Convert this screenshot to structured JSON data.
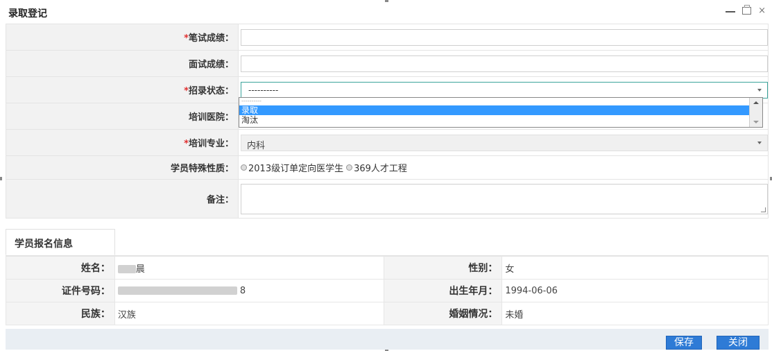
{
  "window": {
    "title": "录取登记",
    "min_icon": "minimize-icon",
    "max_icon": "maximize-icon",
    "close_icon": "close-icon",
    "close_glyph": "×"
  },
  "form": {
    "required_mark": "*",
    "written_score": {
      "label": "笔试成绩：",
      "required": true,
      "value": ""
    },
    "interview_score": {
      "label": "面试成绩：",
      "required": false,
      "value": ""
    },
    "admission_status": {
      "label": "招录状态：",
      "required": true,
      "selected": "----------",
      "options": [
        "----------",
        "录取",
        "淘汰"
      ],
      "highlighted_option": "录取"
    },
    "training_hospital": {
      "label": "培训医院：",
      "required": false,
      "value": ""
    },
    "training_major": {
      "label": "培训专业：",
      "required": true,
      "selected": "内科"
    },
    "special_nature": {
      "label": "学员特殊性质：",
      "options": [
        "2013级订单定向医学生",
        "369人才工程"
      ]
    },
    "remarks": {
      "label": "备注：",
      "value": ""
    }
  },
  "tabs": [
    {
      "label": "学员报名信息",
      "active": true
    }
  ],
  "info": {
    "name": {
      "label": "姓名：",
      "value_suffix": "晨"
    },
    "gender": {
      "label": "性别：",
      "value": "女"
    },
    "id_number": {
      "label": "证件号码：",
      "value_suffix": "8"
    },
    "birth": {
      "label": "出生年月：",
      "value": "1994-06-06"
    },
    "ethnicity": {
      "label": "民族：",
      "value": "汉族"
    },
    "marital": {
      "label": "婚姻情况：",
      "value": "未婚"
    }
  },
  "footer": {
    "save_label": "保存",
    "close_label": "关闭"
  },
  "colors": {
    "accent": "#2e7bd6",
    "highlight": "#3399ff",
    "required": "#e03030",
    "select_focus_border": "#3aa39b"
  }
}
